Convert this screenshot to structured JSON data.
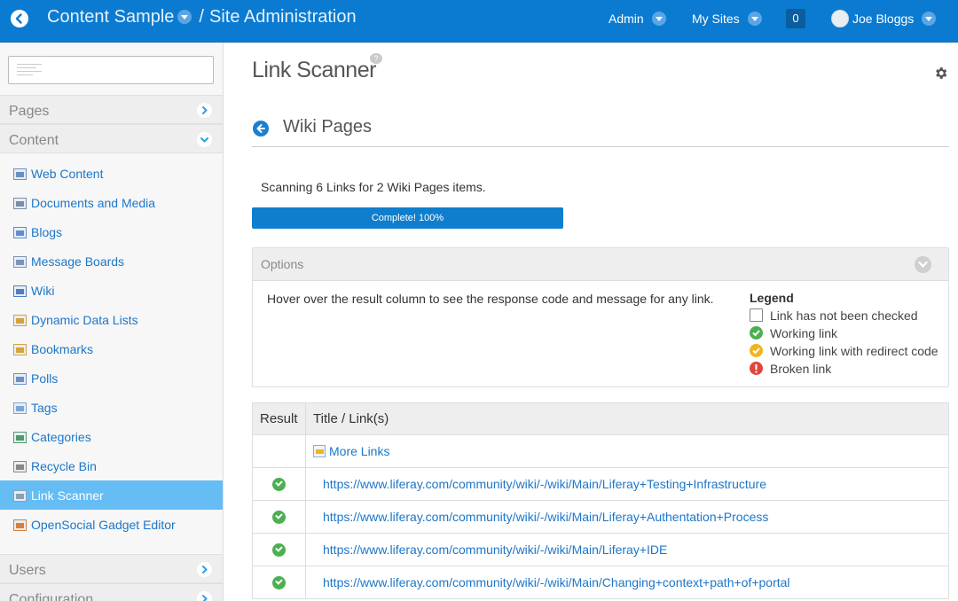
{
  "topbar": {
    "site_name": "Content Sample",
    "separator": "/",
    "section": "Site Administration",
    "admin_label": "Admin",
    "my_sites_label": "My Sites",
    "notification_count": "0",
    "user_name": "Joe Bloggs",
    "accent_color": "#0b7bd1"
  },
  "sidebar": {
    "search": {
      "placeholder": ""
    },
    "sections": {
      "pages": "Pages",
      "content": "Content",
      "users": "Users",
      "configuration": "Configuration"
    },
    "items": [
      {
        "label": "Web Content",
        "icon": "web-content-icon"
      },
      {
        "label": "Documents and Media",
        "icon": "documents-icon"
      },
      {
        "label": "Blogs",
        "icon": "blogs-icon"
      },
      {
        "label": "Message Boards",
        "icon": "message-boards-icon"
      },
      {
        "label": "Wiki",
        "icon": "wiki-icon"
      },
      {
        "label": "Dynamic Data Lists",
        "icon": "data-lists-icon"
      },
      {
        "label": "Bookmarks",
        "icon": "bookmarks-icon"
      },
      {
        "label": "Polls",
        "icon": "polls-icon"
      },
      {
        "label": "Tags",
        "icon": "tags-icon"
      },
      {
        "label": "Categories",
        "icon": "categories-icon"
      },
      {
        "label": "Recycle Bin",
        "icon": "recycle-bin-icon"
      },
      {
        "label": "Link Scanner",
        "icon": "link-icon",
        "active": true
      },
      {
        "label": "OpenSocial Gadget Editor",
        "icon": "gadget-icon"
      }
    ],
    "active_color": "#65bdf4"
  },
  "main": {
    "portlet_title": "Link Scanner",
    "help_glyph": "?",
    "header_title": "Wiki Pages",
    "scan_status": "Scanning 6 Links for 2 Wiki Pages items.",
    "progress": {
      "label": "Complete! 100%",
      "percent": 100
    },
    "options": {
      "title": "Options",
      "hover_text": "Hover over the result column to see the response code and message for any link.",
      "legend_title": "Legend",
      "legend": [
        {
          "label": "Link has not been checked",
          "status": "unchecked"
        },
        {
          "label": "Working link",
          "status": "ok",
          "color": "#4caf50"
        },
        {
          "label": "Working link with redirect code",
          "status": "redirect",
          "color": "#f0b51e"
        },
        {
          "label": "Broken link",
          "status": "broken",
          "color": "#e0453c"
        }
      ]
    },
    "table": {
      "headers": [
        "Result",
        "Title / Link(s)"
      ],
      "more_links_label": "More Links",
      "rows": [
        {
          "status": "ok",
          "url": "https://www.liferay.com/community/wiki/-/wiki/Main/Liferay+Testing+Infrastructure"
        },
        {
          "status": "ok",
          "url": "https://www.liferay.com/community/wiki/-/wiki/Main/Liferay+Authentation+Process"
        },
        {
          "status": "ok",
          "url": "https://www.liferay.com/community/wiki/-/wiki/Main/Liferay+IDE"
        },
        {
          "status": "ok",
          "url": "https://www.liferay.com/community/wiki/-/wiki/Main/Changing+context+path+of+portal"
        }
      ]
    }
  }
}
